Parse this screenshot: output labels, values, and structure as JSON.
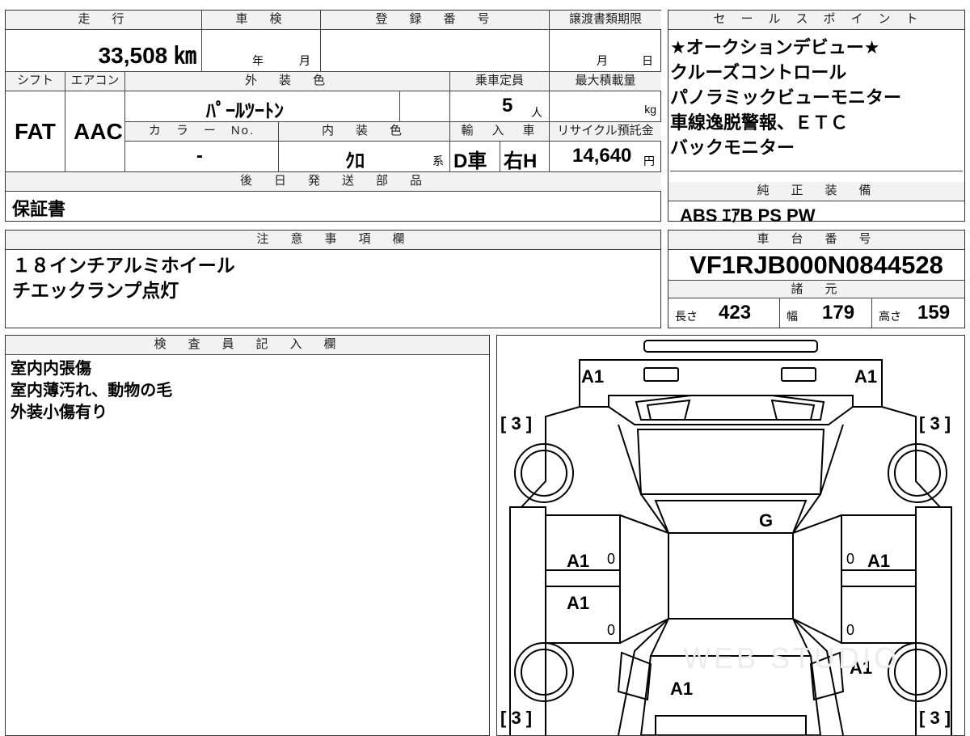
{
  "top_row": {
    "mileage_header": "走　行",
    "mileage_value": "33,508 ㎞",
    "inspection_header": "車　検",
    "inspection_year": "年",
    "inspection_month": "月",
    "registration_header": "登　録　番　号",
    "transfer_header": "譲渡書類期限",
    "transfer_month": "月",
    "transfer_day": "日"
  },
  "second_row": {
    "shift_header": "シフト",
    "shift_value": "FAT",
    "aircon_header": "エアコン",
    "aircon_value": "AAC",
    "exterior_color_header": "外　装　色",
    "exterior_color_value": "ﾊﾟｰﾙﾂｰﾄﾝ",
    "capacity_header": "乗車定員",
    "capacity_value": "5",
    "capacity_unit": "人",
    "max_load_header": "最大積載量",
    "max_load_unit": "kg",
    "color_no_header": "カ　ラ　ー　No.",
    "color_no_value": "-",
    "interior_color_header": "内　装　色",
    "interior_color_value": "ｸﾛ",
    "interior_suffix": "系",
    "import_header": "輸　入　車",
    "import_value_1": "D車",
    "import_value_2": "右H",
    "recycle_header": "リサイクル預託金",
    "recycle_value": "14,640",
    "recycle_unit": "円"
  },
  "later_parts": {
    "header": "後　日　発　送　部　品",
    "value": "保証書"
  },
  "sales_points": {
    "header": "セ　ー　ル　ス　ポ　イ　ン　ト",
    "items": [
      "★オークションデビュー★",
      "クルーズコントロール",
      "パノラミックビューモニター",
      "車線逸脱警報、ＥＴＣ",
      "バックモニター"
    ]
  },
  "genuine_equipment": {
    "header": "純　正　装　備",
    "value": "ABS ｴｱB PS PW"
  },
  "notes": {
    "header": "注　意　事　項　欄",
    "lines": [
      "１８インチアルミホイール",
      "チエックランプ点灯"
    ]
  },
  "chassis": {
    "header": "車　台　番　号",
    "value": "VF1RJB000N0844528",
    "specs_header": "諸　元",
    "length_label": "長さ",
    "length_value": "423",
    "width_label": "幅",
    "width_value": "179",
    "height_label": "高さ",
    "height_value": "159"
  },
  "inspector": {
    "header": "検　査　員　記　入　欄",
    "lines": [
      "室内内張傷",
      "室内薄汚れ、動物の毛",
      "外装小傷有り"
    ]
  },
  "diagram": {
    "marks": {
      "front_left": "A1",
      "front_right": "A1",
      "tl_bracket": "[ 3 ]",
      "tr_bracket": "[ 3 ]",
      "bl_bracket": "[ 3 ]",
      "br_bracket": "[ 3 ]",
      "glass": "G",
      "left_front_door": "A1",
      "left_rear_door": "A1",
      "right_front_door": "A1",
      "right_rear_quarter": "A1",
      "rear": "A1",
      "zero_1": "0",
      "zero_2": "0",
      "zero_3": "0",
      "zero_4": "0"
    },
    "watermark": "WEB STUDIO"
  }
}
